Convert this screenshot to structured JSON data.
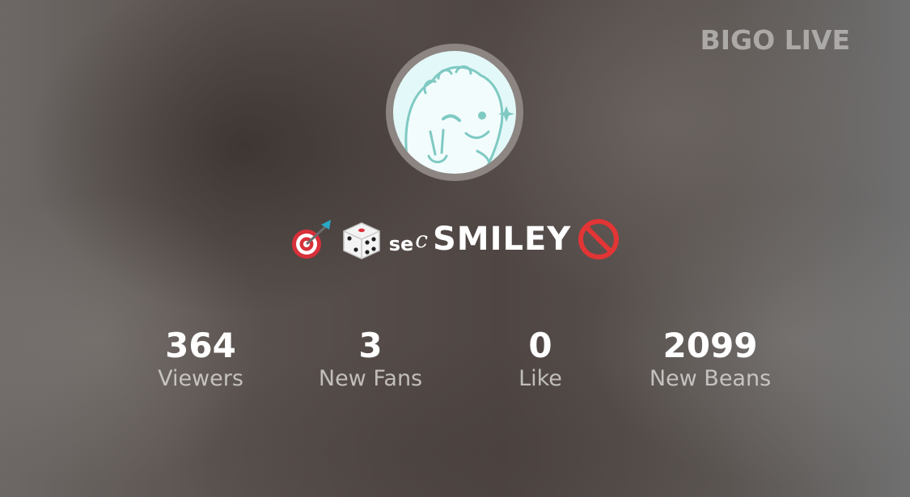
{
  "brand": {
    "logo_text": "BIGO LIVE"
  },
  "profile": {
    "avatar_icon": "dino-mascot-avatar-icon",
    "name_prefix_icons": [
      "target-dart-icon",
      "dice-icon"
    ],
    "name_small": "se",
    "name_script": "c",
    "name_main": "SMILEY",
    "name_suffix_icon": "prohibited-icon"
  },
  "stats": [
    {
      "value": "364",
      "label": "Viewers"
    },
    {
      "value": "3",
      "label": "New Fans"
    },
    {
      "value": "0",
      "label": "Like"
    },
    {
      "value": "2099",
      "label": "New Beans"
    }
  ],
  "colors": {
    "avatar_bg": "#e3f8f8",
    "avatar_line": "#7fc9c3",
    "ring": "#8c8582",
    "stat_value": "#ffffff",
    "stat_label": "#d8d6d4"
  }
}
